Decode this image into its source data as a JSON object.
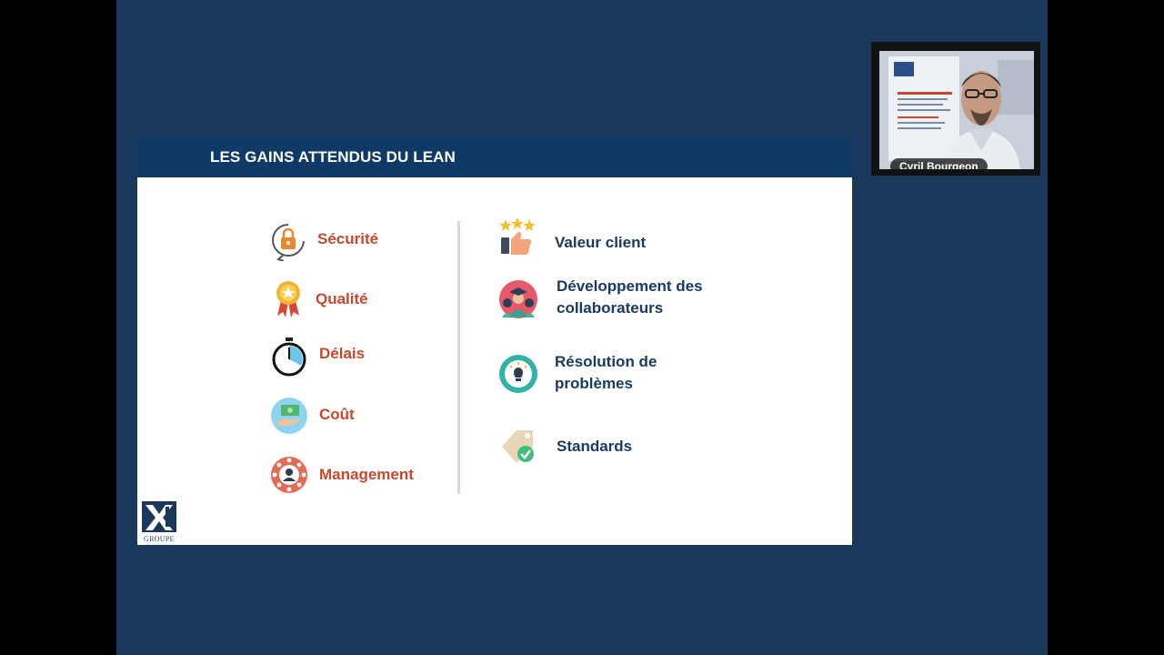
{
  "slide": {
    "title": "LES GAINS ATTENDUS DU LEAN",
    "left_items": [
      {
        "label": "Sécurité",
        "icon": "lock-cycle-icon"
      },
      {
        "label": "Qualité",
        "icon": "medal-icon"
      },
      {
        "label": "Délais",
        "icon": "stopwatch-icon"
      },
      {
        "label": "Coût",
        "icon": "money-hand-icon"
      },
      {
        "label": "Management",
        "icon": "team-network-icon"
      }
    ],
    "right_items": [
      {
        "line1": "Valeur client",
        "line2": "",
        "icon": "stars-thumbs-up-icon"
      },
      {
        "line1": "Développement des",
        "line2": "collaborateurs",
        "icon": "graduate-icon"
      },
      {
        "line1": "Résolution de",
        "line2": "problèmes",
        "icon": "lightbulb-icon"
      },
      {
        "line1": "Standards",
        "line2": "",
        "icon": "tag-check-icon"
      }
    ],
    "logo_text": "GROUPE"
  },
  "camera": {
    "participant_name": "Cyril Bourgeon"
  },
  "colors": {
    "background": "#1c375c",
    "header": "#0f3a67",
    "accent_red": "#c54a2b",
    "text_blue": "#1a3a63"
  }
}
